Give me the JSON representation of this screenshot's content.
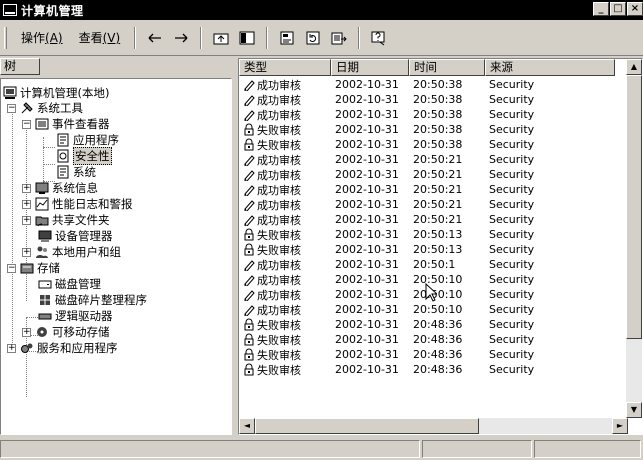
{
  "window": {
    "title": "计算机管理",
    "buttons": [
      "_",
      "□",
      "×"
    ]
  },
  "menu": [
    {
      "label": "操作",
      "accel": "(A)"
    },
    {
      "label": "查看",
      "accel": "(V)"
    }
  ],
  "toolbar_icons": [
    "back-arrow-icon",
    "forward-arrow-icon",
    "up-folder-icon",
    "show-tree-icon",
    "properties-icon",
    "refresh-icon",
    "export-icon",
    "help-icon"
  ],
  "tree": {
    "header": "树",
    "items": [
      {
        "label": "计算机管理(本地)",
        "icon": "computer-icon",
        "level": 0
      },
      {
        "label": "系统工具",
        "icon": "tools-icon",
        "level": 1,
        "expander": "-"
      },
      {
        "label": "事件查看器",
        "icon": "event-viewer-icon",
        "level": 2,
        "expander": "-"
      },
      {
        "label": "应用程序",
        "icon": "log-icon",
        "level": 3
      },
      {
        "label": "安全性",
        "icon": "security-log-icon",
        "level": 3,
        "selected": true
      },
      {
        "label": "系统",
        "icon": "log-icon",
        "level": 3
      },
      {
        "label": "系统信息",
        "icon": "system-info-icon",
        "level": 2,
        "expander": "+"
      },
      {
        "label": "性能日志和警报",
        "icon": "performance-icon",
        "level": 2,
        "expander": "+"
      },
      {
        "label": "共享文件夹",
        "icon": "shared-folder-icon",
        "level": 2,
        "expander": "+"
      },
      {
        "label": "设备管理器",
        "icon": "device-manager-icon",
        "level": 2
      },
      {
        "label": "本地用户和组",
        "icon": "users-icon",
        "level": 2,
        "expander": "+"
      },
      {
        "label": "存储",
        "icon": "storage-icon",
        "level": 1,
        "expander": "-"
      },
      {
        "label": "磁盘管理",
        "icon": "disk-icon",
        "level": 2
      },
      {
        "label": "磁盘碎片整理程序",
        "icon": "defrag-icon",
        "level": 2
      },
      {
        "label": "逻辑驱动器",
        "icon": "drive-icon",
        "level": 2
      },
      {
        "label": "可移动存储",
        "icon": "removable-storage-icon",
        "level": 2,
        "expander": "+"
      },
      {
        "label": "服务和应用程序",
        "icon": "services-icon",
        "level": 1,
        "expander": "+"
      }
    ]
  },
  "list": {
    "columns": [
      "类型",
      "日期",
      "时间",
      "来源"
    ],
    "rows": [
      {
        "type": "成功审核",
        "kind": "success",
        "date": "2002-10-31",
        "time": "20:50:38",
        "source": "Security"
      },
      {
        "type": "成功审核",
        "kind": "success",
        "date": "2002-10-31",
        "time": "20:50:38",
        "source": "Security"
      },
      {
        "type": "成功审核",
        "kind": "success",
        "date": "2002-10-31",
        "time": "20:50:38",
        "source": "Security"
      },
      {
        "type": "失败审核",
        "kind": "failure",
        "date": "2002-10-31",
        "time": "20:50:38",
        "source": "Security"
      },
      {
        "type": "失败审核",
        "kind": "failure",
        "date": "2002-10-31",
        "time": "20:50:38",
        "source": "Security"
      },
      {
        "type": "成功审核",
        "kind": "success",
        "date": "2002-10-31",
        "time": "20:50:21",
        "source": "Security"
      },
      {
        "type": "成功审核",
        "kind": "success",
        "date": "2002-10-31",
        "time": "20:50:21",
        "source": "Security"
      },
      {
        "type": "成功审核",
        "kind": "success",
        "date": "2002-10-31",
        "time": "20:50:21",
        "source": "Security"
      },
      {
        "type": "成功审核",
        "kind": "success",
        "date": "2002-10-31",
        "time": "20:50:21",
        "source": "Security"
      },
      {
        "type": "成功审核",
        "kind": "success",
        "date": "2002-10-31",
        "time": "20:50:21",
        "source": "Security"
      },
      {
        "type": "失败审核",
        "kind": "failure",
        "date": "2002-10-31",
        "time": "20:50:13",
        "source": "Security"
      },
      {
        "type": "失败审核",
        "kind": "failure",
        "date": "2002-10-31",
        "time": "20:50:13",
        "source": "Security"
      },
      {
        "type": "成功审核",
        "kind": "success",
        "date": "2002-10-31",
        "time": "20:50:1",
        "source": "Security"
      },
      {
        "type": "成功审核",
        "kind": "success",
        "date": "2002-10-31",
        "time": "20:50:10",
        "source": "Security"
      },
      {
        "type": "成功审核",
        "kind": "success",
        "date": "2002-10-31",
        "time": "20:50:10",
        "source": "Security"
      },
      {
        "type": "成功审核",
        "kind": "success",
        "date": "2002-10-31",
        "time": "20:50:10",
        "source": "Security"
      },
      {
        "type": "失败审核",
        "kind": "failure",
        "date": "2002-10-31",
        "time": "20:48:36",
        "source": "Security"
      },
      {
        "type": "失败审核",
        "kind": "failure",
        "date": "2002-10-31",
        "time": "20:48:36",
        "source": "Security"
      },
      {
        "type": "失败审核",
        "kind": "failure",
        "date": "2002-10-31",
        "time": "20:48:36",
        "source": "Security"
      },
      {
        "type": "失败审核",
        "kind": "failure",
        "date": "2002-10-31",
        "time": "20:48:36",
        "source": "Security"
      }
    ]
  }
}
